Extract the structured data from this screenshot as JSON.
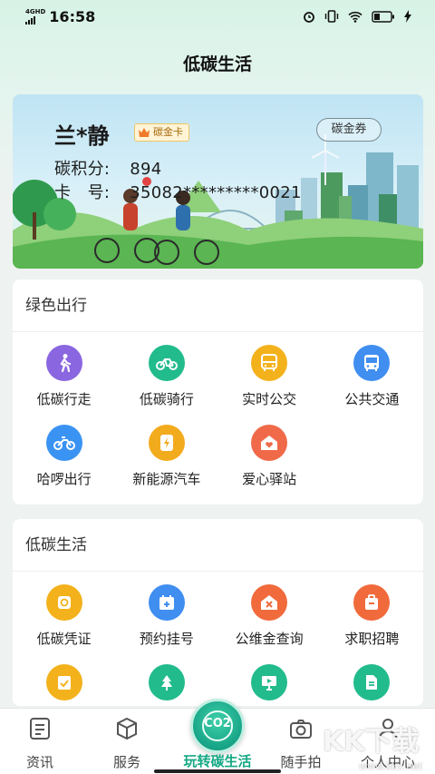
{
  "status_bar": {
    "network": "4GHD",
    "time": "16:58"
  },
  "header": {
    "title": "低碳生活"
  },
  "card": {
    "name": "兰*静",
    "badge": "碳金卡",
    "coupon_button": "碳金券",
    "points_label": "碳积分:",
    "points_value": "894",
    "card_no_label": "卡　号:",
    "card_no_value": "35082*********0021"
  },
  "sections": [
    {
      "title": "绿色出行",
      "items": [
        {
          "label": "低碳行走",
          "icon": "walking-icon",
          "color": "#8a66e0"
        },
        {
          "label": "低碳骑行",
          "icon": "bicycle-icon",
          "color": "#22bb8c"
        },
        {
          "label": "实时公交",
          "icon": "bus-icon",
          "color": "#f3b21c"
        },
        {
          "label": "公共交通",
          "icon": "bus-front-icon",
          "color": "#3f8ef0"
        },
        {
          "label": "哈啰出行",
          "icon": "bike-share-icon",
          "color": "#3a93f2"
        },
        {
          "label": "新能源汽车",
          "icon": "charging-icon",
          "color": "#f2ab1d"
        },
        {
          "label": "爱心驿站",
          "icon": "heart-house-icon",
          "color": "#f06a4a"
        }
      ]
    },
    {
      "title": "低碳生活",
      "items": [
        {
          "label": "低碳凭证",
          "icon": "voucher-icon",
          "color": "#f3b21c"
        },
        {
          "label": "预约挂号",
          "icon": "calendar-plus-icon",
          "color": "#3f8ef0"
        },
        {
          "label": "公维金查询",
          "icon": "house-tools-icon",
          "color": "#f06a3c"
        },
        {
          "label": "求职招聘",
          "icon": "briefcase-icon",
          "color": "#f06a3c"
        },
        {
          "label": "",
          "icon": "checklist-icon",
          "color": "#f3b21c"
        },
        {
          "label": "",
          "icon": "tree-icon",
          "color": "#22bb8c"
        },
        {
          "label": "",
          "icon": "monitor-icon",
          "color": "#22bb8c"
        },
        {
          "label": "",
          "icon": "document-icon",
          "color": "#22bb8c"
        }
      ]
    }
  ],
  "bottom_nav": {
    "items": [
      {
        "label": "资讯",
        "icon": "news-icon"
      },
      {
        "label": "服务",
        "icon": "cube-icon"
      },
      {
        "label": "玩转碳生活",
        "icon": "co2-icon"
      },
      {
        "label": "随手拍",
        "icon": "camera-icon"
      },
      {
        "label": "个人中心",
        "icon": "user-icon"
      }
    ],
    "center_badge": "CO2"
  },
  "watermark": {
    "text": "KK下载",
    "url": "www.kkx.net"
  },
  "colors": {
    "accent": "#14a884",
    "badge_bg": "#fff4d6"
  }
}
